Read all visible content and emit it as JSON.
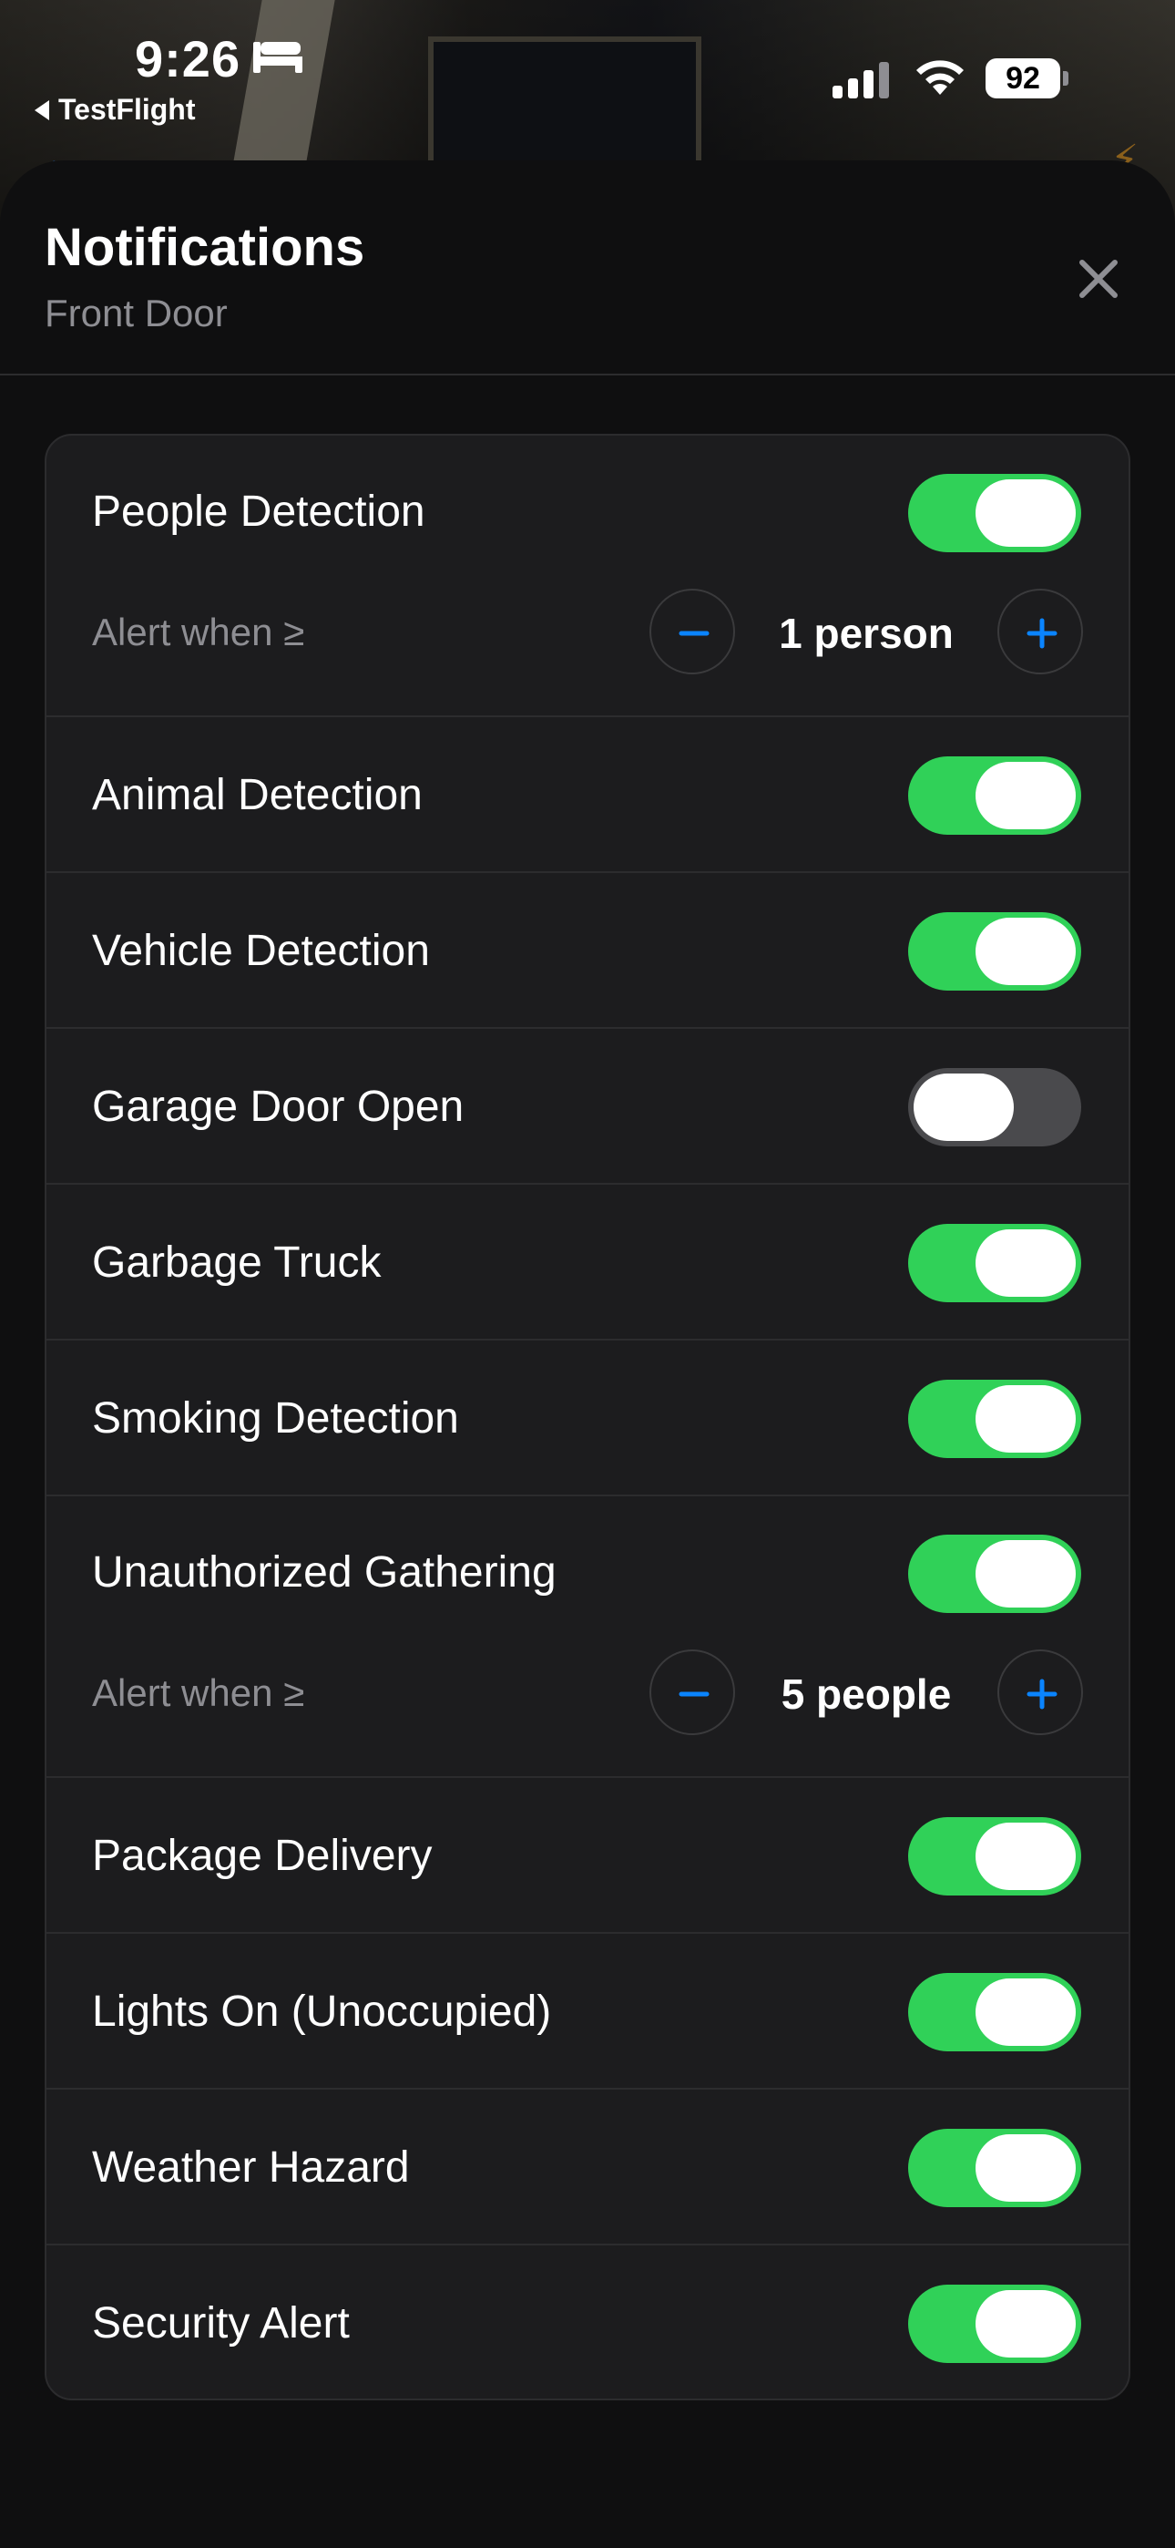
{
  "status_bar": {
    "time": "9:26",
    "back_app": "TestFlight",
    "battery": "92"
  },
  "sheet": {
    "title": "Notifications",
    "subtitle": "Front Door"
  },
  "rows": [
    {
      "label": "People Detection",
      "on": true,
      "stepper": {
        "alert_label": "Alert when ≥",
        "value": "1 person"
      }
    },
    {
      "label": "Animal Detection",
      "on": true
    },
    {
      "label": "Vehicle Detection",
      "on": true
    },
    {
      "label": "Garage Door Open",
      "on": false
    },
    {
      "label": "Garbage Truck",
      "on": true
    },
    {
      "label": "Smoking Detection",
      "on": true
    },
    {
      "label": "Unauthorized Gathering",
      "on": true,
      "stepper": {
        "alert_label": "Alert when ≥",
        "value": "5 people"
      }
    },
    {
      "label": "Package Delivery",
      "on": true
    },
    {
      "label": "Lights On (Unoccupied)",
      "on": true
    },
    {
      "label": "Weather Hazard",
      "on": true
    },
    {
      "label": "Security Alert",
      "on": true
    }
  ],
  "colors": {
    "toggle_on": "#30d158",
    "toggle_off": "#4a4a4d",
    "accent_blue": "#0a84ff"
  }
}
